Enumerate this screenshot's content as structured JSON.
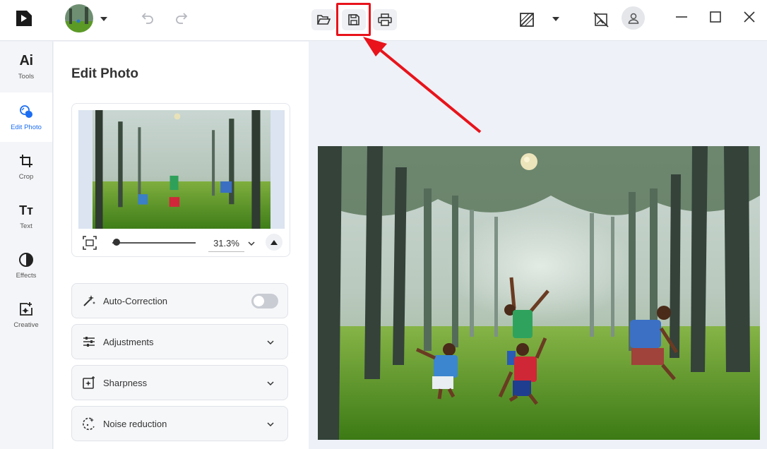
{
  "nav": {
    "items": [
      {
        "label": "Tools",
        "icon": "ai-tools-icon"
      },
      {
        "label": "Edit Photo",
        "icon": "edit-photo-icon"
      },
      {
        "label": "Crop",
        "icon": "crop-icon"
      },
      {
        "label": "Text",
        "icon": "text-icon"
      },
      {
        "label": "Effects",
        "icon": "effects-icon"
      },
      {
        "label": "Creative",
        "icon": "creative-icon"
      }
    ],
    "ai_glyph": "Ai",
    "text_glyph": "Tт",
    "active": "Edit Photo"
  },
  "panel": {
    "title": "Edit Photo",
    "zoom_value": "31.3%",
    "zoom_level": 0.05,
    "sections": [
      {
        "label": "Auto-Correction",
        "control": "toggle",
        "on": false
      },
      {
        "label": "Adjustments",
        "control": "chevron"
      },
      {
        "label": "Sharpness",
        "control": "chevron"
      },
      {
        "label": "Noise reduction",
        "control": "chevron"
      }
    ]
  },
  "toolbar": {
    "buttons": [
      "open-folder-icon",
      "save-icon",
      "print-icon"
    ],
    "highlighted": "save-icon"
  },
  "colors": {
    "accent": "#1c6ef2",
    "highlight": "#e8131b",
    "grass": "#5c9a26"
  }
}
